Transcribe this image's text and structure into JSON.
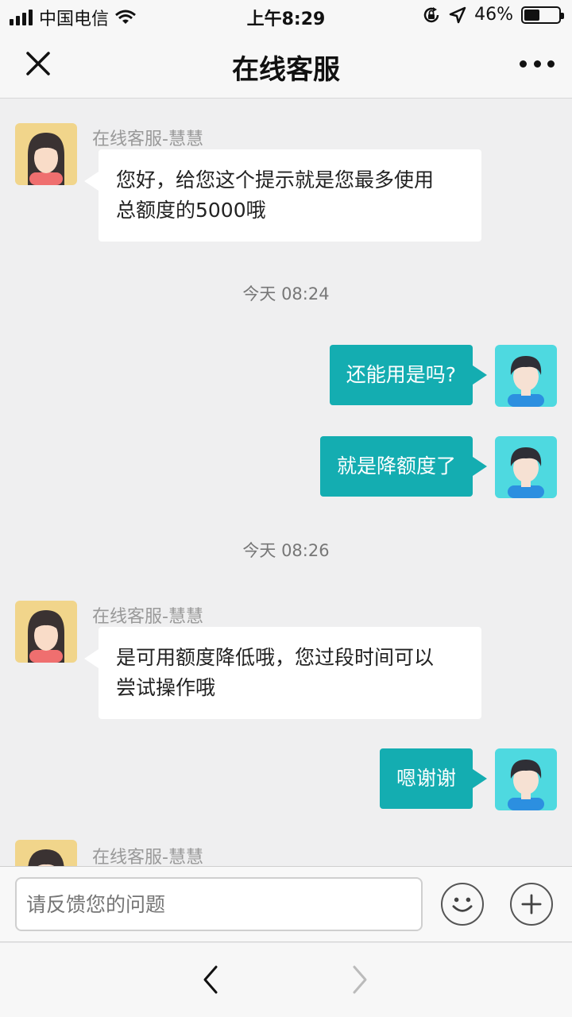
{
  "status_bar": {
    "carrier": "中国电信",
    "time": "上午8:29",
    "battery": "46%",
    "battery_level": 0.46,
    "icons": [
      "signal-icon",
      "wifi-icon",
      "rotation-lock-icon",
      "location-icon",
      "battery-icon"
    ]
  },
  "header": {
    "title": "在线客服",
    "close_icon": "close-icon",
    "more_icon": "more-icon"
  },
  "messages": [
    {
      "sender": "在线客服-慧慧",
      "text_lines": [
        "您好，给您这个提示就是您最多使用",
        "总额度的5000哦"
      ]
    },
    {
      "timestamp": "今天 08:24"
    },
    {
      "text": "还能用是吗?"
    },
    {
      "text": "就是降额度了"
    },
    {
      "timestamp": "今天 08:26"
    },
    {
      "sender": "在线客服-慧慧",
      "text_lines": [
        "是可用额度降低哦，您过段时间可以",
        "尝试操作哦"
      ]
    },
    {
      "text": "嗯谢谢"
    },
    {
      "sender": "在线客服-慧慧"
    }
  ],
  "input": {
    "placeholder": "请反馈您的问题",
    "emoji_icon": "emoji-icon",
    "add_icon": "plus-icon"
  },
  "browser": {
    "back_icon": "chevron-left-icon",
    "forward_icon": "chevron-right-icon"
  },
  "colors": {
    "outgoing_bubble": "#14adb1",
    "agent_avatar_bg": "#f1d58b",
    "user_avatar_bg": "#4ed9e0",
    "background": "#efeff0"
  }
}
